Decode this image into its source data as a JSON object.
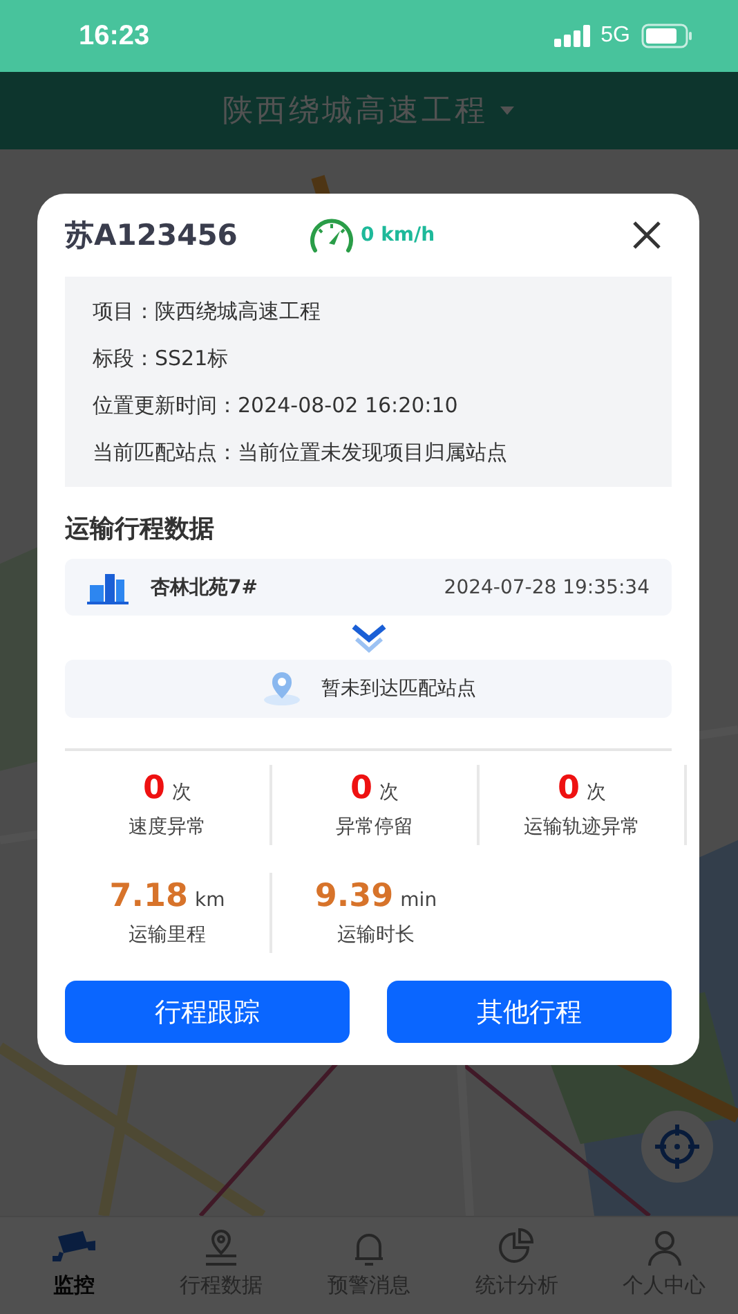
{
  "status_bar": {
    "time": "16:23",
    "network": "5G"
  },
  "header": {
    "title": "陕西绕城高速工程"
  },
  "vehicle_card": {
    "plate": "苏A123456",
    "speed": "0 km/h",
    "info": [
      {
        "label": "项目：",
        "value": "陕西绕城高速工程"
      },
      {
        "label": "标段：",
        "value": "SS21标"
      },
      {
        "label": "位置更新时间：",
        "value": "2024-08-02 16:20:10"
      },
      {
        "label": "当前匹配站点：",
        "value": "当前位置未发现项目归属站点"
      }
    ],
    "section_title": "运输行程数据",
    "origin": {
      "name": "杏林北苑7#",
      "time": "2024-07-28 19:35:34"
    },
    "destination": {
      "text": "暂未到达匹配站点"
    },
    "stats": [
      {
        "kind": "alert",
        "value": "0",
        "unit": "次",
        "label": "速度异常"
      },
      {
        "kind": "alert",
        "value": "0",
        "unit": "次",
        "label": "异常停留"
      },
      {
        "kind": "alert",
        "value": "0",
        "unit": "次",
        "label": "运输轨迹异常"
      },
      {
        "kind": "metric",
        "value": "7.18",
        "unit": "km",
        "label": "运输里程"
      },
      {
        "kind": "metric",
        "value": "9.39",
        "unit": "min",
        "label": "运输时长"
      }
    ],
    "buttons": [
      "行程跟踪",
      "其他行程"
    ]
  },
  "tab_bar": [
    {
      "label": "监控",
      "selected": true
    },
    {
      "label": "行程数据",
      "selected": false
    },
    {
      "label": "预警消息",
      "selected": false
    },
    {
      "label": "统计分析",
      "selected": false
    },
    {
      "label": "个人中心",
      "selected": false
    }
  ]
}
